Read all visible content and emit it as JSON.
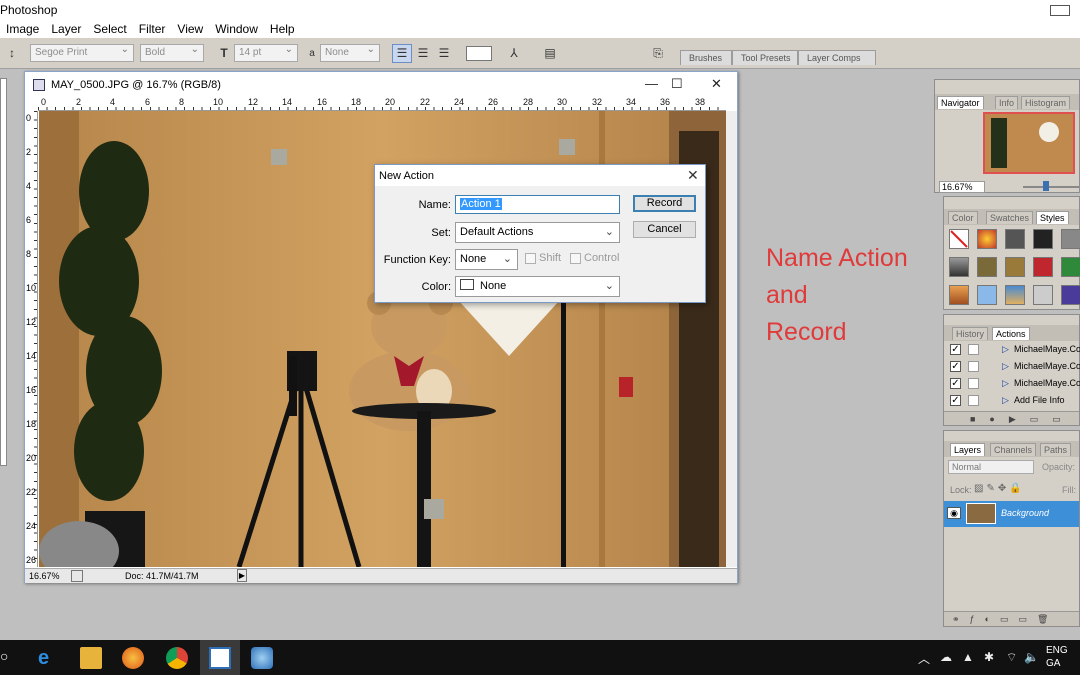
{
  "app": {
    "title": "Photoshop"
  },
  "menu": [
    "Image",
    "Layer",
    "Select",
    "Filter",
    "View",
    "Window",
    "Help"
  ],
  "options_bar": {
    "font_family": "Segoe Print",
    "font_style": "Bold",
    "font_size": "14 pt",
    "anti_alias": "None",
    "font_size_icon": "T",
    "anti_alias_icon": "a",
    "panel_tabs": [
      "Brushes",
      "Tool Presets",
      "Layer Comps"
    ]
  },
  "document": {
    "title": "MAY_0500.JPG @ 16.7% (RGB/8)",
    "ruler_top": [
      "0",
      "2",
      "4",
      "6",
      "8",
      "10",
      "12",
      "14",
      "16",
      "18",
      "20",
      "22",
      "24",
      "26",
      "28",
      "30",
      "32",
      "34",
      "36",
      "38"
    ],
    "ruler_left": [
      "0",
      "2",
      "4",
      "6",
      "8",
      "10",
      "12",
      "14",
      "16",
      "18",
      "20",
      "22",
      "24",
      "26"
    ],
    "zoom": "16.67%",
    "doc_info": "Doc: 41.7M/41.7M"
  },
  "dialog": {
    "title": "New Action",
    "name_label": "Name:",
    "name_value": "Action 1",
    "set_label": "Set:",
    "set_value": "Default Actions",
    "fkey_label": "Function Key:",
    "fkey_value": "None",
    "shift_label": "Shift",
    "control_label": "Control",
    "color_label": "Color:",
    "color_value": "None",
    "record_button": "Record",
    "cancel_button": "Cancel"
  },
  "annotation": {
    "line1": "Name Action",
    "line2": "and",
    "line3": "Record",
    "color": "#e03a3a"
  },
  "navigator_panel": {
    "tabs": [
      "Navigator",
      "Info",
      "Histogram"
    ],
    "zoom": "16.67%"
  },
  "color_panel": {
    "tabs": [
      "Color",
      "Swatches",
      "Styles"
    ]
  },
  "actions_panel": {
    "tabs": [
      "History",
      "Actions"
    ],
    "items": [
      "MichaelMaye.Co",
      "MichaelMaye.Co",
      "MichaelMaye.Co",
      "Add File Info"
    ]
  },
  "layers_panel": {
    "tabs": [
      "Layers",
      "Channels",
      "Paths"
    ],
    "blend_mode": "Normal",
    "opacity_label": "Opacity:",
    "lock_label": "Lock:",
    "fill_label": "Fill:",
    "layer_name": "Background"
  },
  "taskbar": {
    "lang": "ENG",
    "region": "GA"
  },
  "colors": {
    "accent": "#3c7fb1",
    "selected_layer": "#3d8fd8",
    "wall": "#c49352"
  }
}
